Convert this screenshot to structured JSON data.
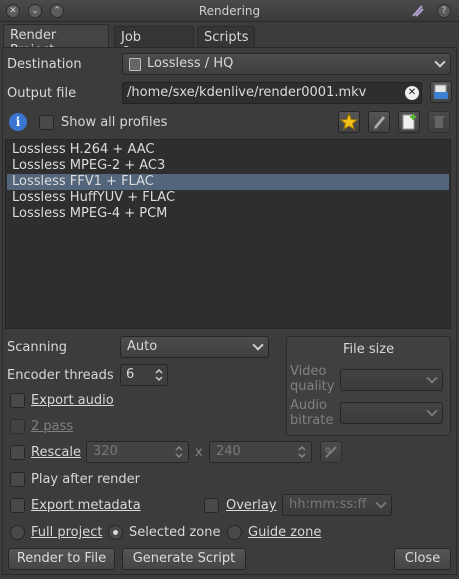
{
  "window": {
    "title": "Rendering"
  },
  "tabs": [
    {
      "label": "Render Project"
    },
    {
      "label": "Job Queue"
    },
    {
      "label": "Scripts"
    }
  ],
  "destination": {
    "label": "Destination",
    "value": "Lossless / HQ"
  },
  "output": {
    "label": "Output file",
    "value": "/home/sxe/kdenlive/render0001.mkv"
  },
  "profiles_toggle": {
    "label": "Show all profiles"
  },
  "profiles": [
    {
      "label": "Lossless H.264 + AAC"
    },
    {
      "label": "Lossless MPEG-2 + AC3"
    },
    {
      "label": "Lossless FFV1 + FLAC"
    },
    {
      "label": "Lossless HuffYUV + FLAC"
    },
    {
      "label": "Lossless MPEG-4 + PCM"
    }
  ],
  "scanning": {
    "label": "Scanning",
    "value": "Auto"
  },
  "encoder": {
    "label": "Encoder threads",
    "value": "6"
  },
  "file_size": {
    "title": "File size",
    "video_quality": "Video quality",
    "audio_bitrate": "Audio bitrate"
  },
  "export_audio": {
    "label": "Export audio"
  },
  "two_pass": {
    "label": "2 pass"
  },
  "rescale": {
    "label": "Rescale",
    "width": "320",
    "height": "240",
    "x": "x"
  },
  "play_after": {
    "label": "Play after render"
  },
  "export_metadata": {
    "label": "Export metadata"
  },
  "overlay": {
    "label": "Overlay",
    "value": "hh:mm:ss:ff"
  },
  "zones": {
    "full": "Full project",
    "selected": "Selected zone",
    "guide": "Guide zone"
  },
  "buttons": {
    "render": "Render to File",
    "script": "Generate Script",
    "close": "Close"
  },
  "colors": {
    "selection": "#53657a",
    "background": "#3c3c3c"
  }
}
